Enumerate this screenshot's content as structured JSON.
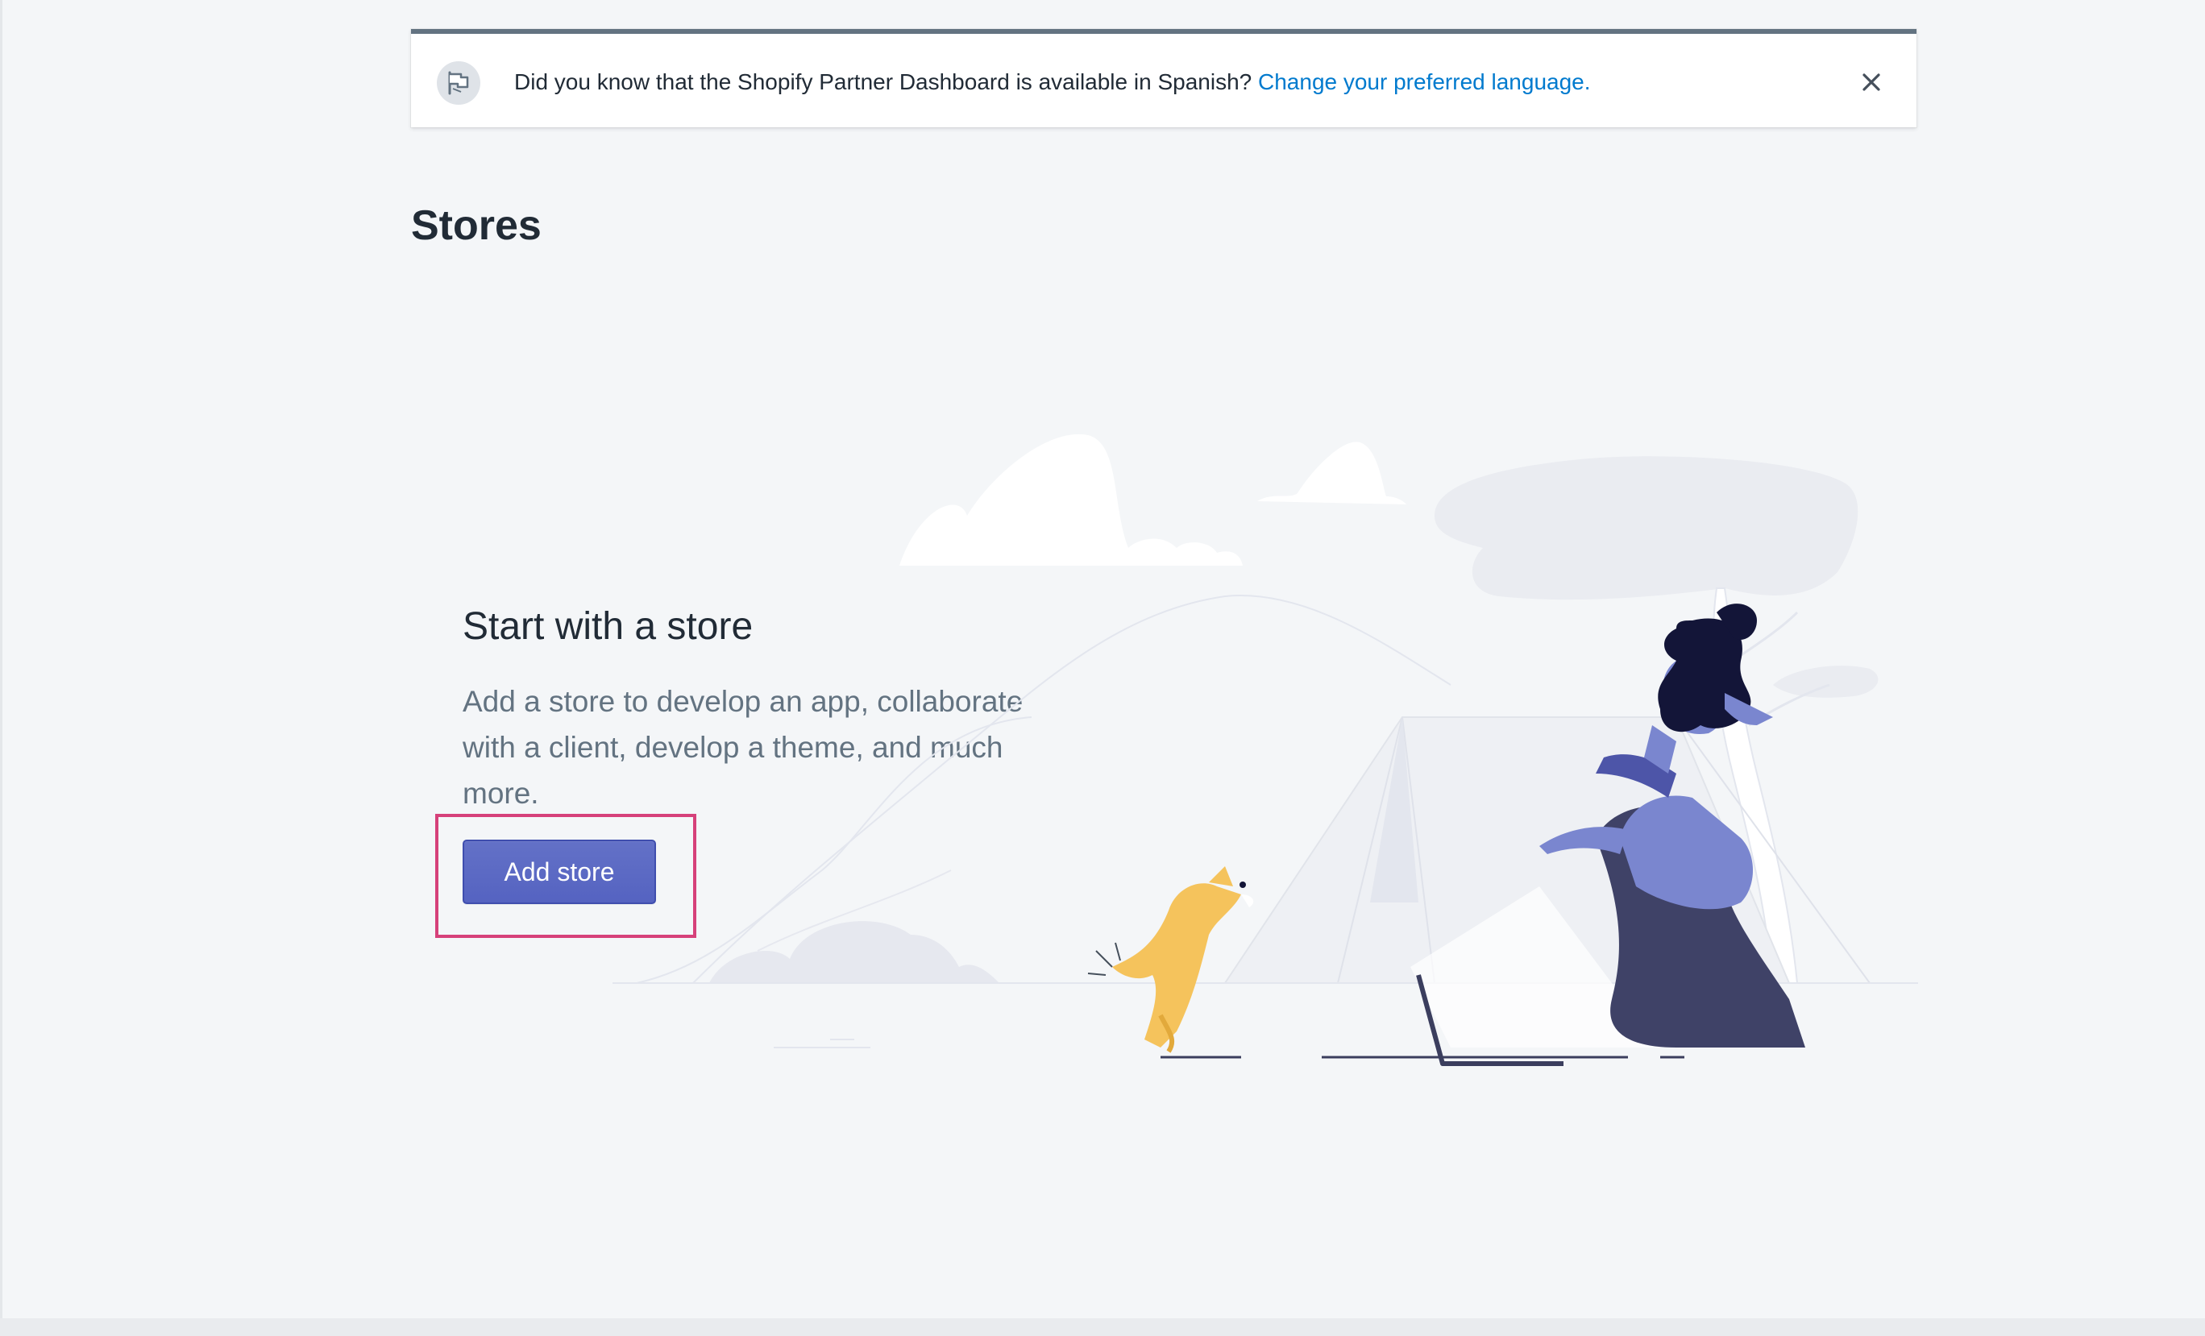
{
  "banner": {
    "message": "Did you know that the Shopify Partner Dashboard is available in Spanish?",
    "link_text": "Change your preferred language.",
    "icon": "flag-icon",
    "close_icon": "close-icon"
  },
  "page": {
    "title": "Stores"
  },
  "empty_state": {
    "heading": "Start with a store",
    "body": "Add a store to develop an app, collaborate with a client, develop a theme, and much more.",
    "button_label": "Add store",
    "illustration": "camping-illustration"
  },
  "colors": {
    "accent": "#5c6ac4",
    "link": "#007ace",
    "highlight": "#d6417a",
    "background": "#f4f6f8"
  }
}
